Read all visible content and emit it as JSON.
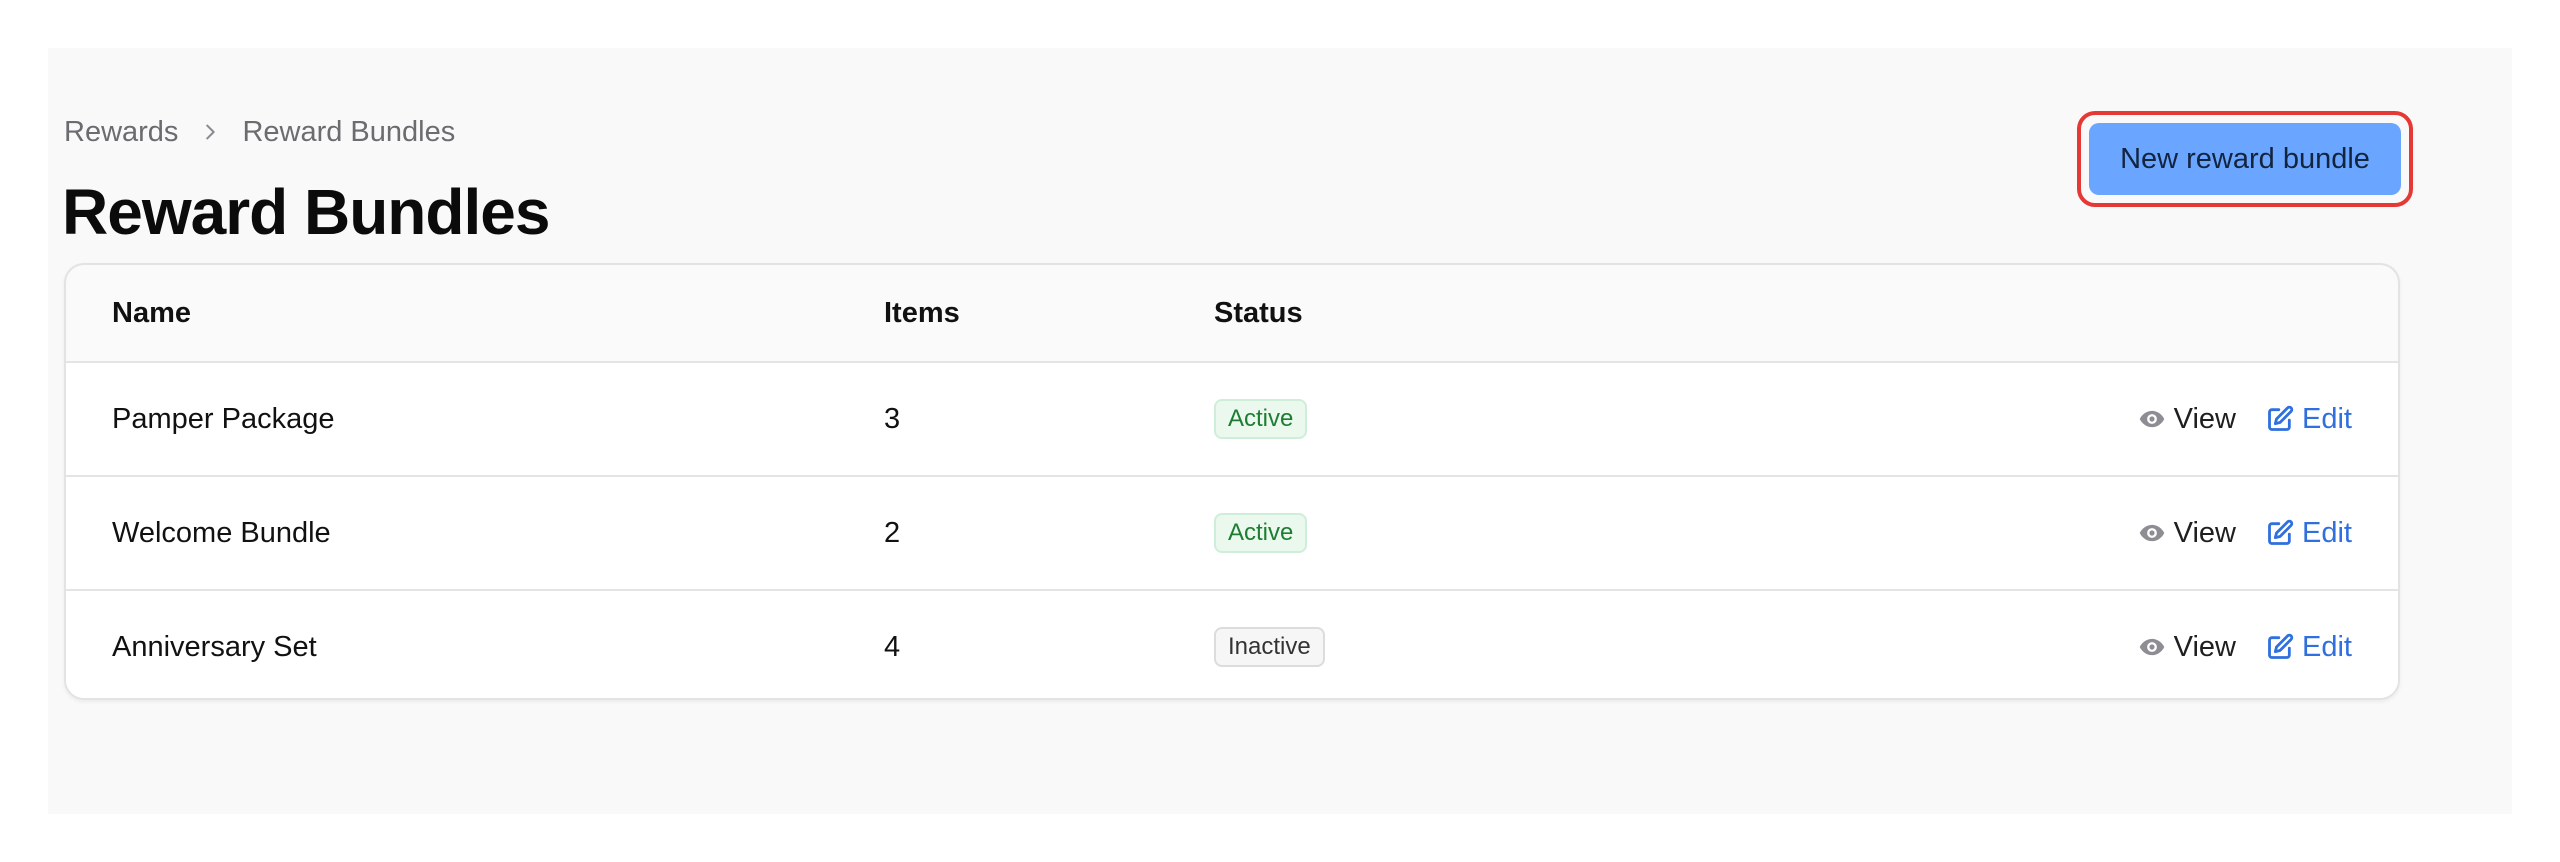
{
  "breadcrumb": {
    "items": [
      "Rewards",
      "Reward Bundles"
    ]
  },
  "page": {
    "title": "Reward Bundles"
  },
  "toolbar": {
    "new_button_label": "New reward bundle"
  },
  "table": {
    "columns": [
      "Name",
      "Items",
      "Status"
    ],
    "rows": [
      {
        "name": "Pamper Package",
        "items": "3",
        "status": "Active",
        "view": "View",
        "edit": "Edit"
      },
      {
        "name": "Welcome Bundle",
        "items": "2",
        "status": "Active",
        "view": "View",
        "edit": "Edit"
      },
      {
        "name": "Anniversary Set",
        "items": "4",
        "status": "Inactive",
        "view": "View",
        "edit": "Edit"
      }
    ]
  },
  "colors": {
    "accent_button": "#6aa6ff",
    "highlight_ring": "#e53935",
    "active_text": "#1e7d32",
    "edit_link": "#2f6fde"
  },
  "icons": {
    "breadcrumb_separator": "chevron-right-icon",
    "view": "eye-icon",
    "edit": "edit-icon"
  }
}
